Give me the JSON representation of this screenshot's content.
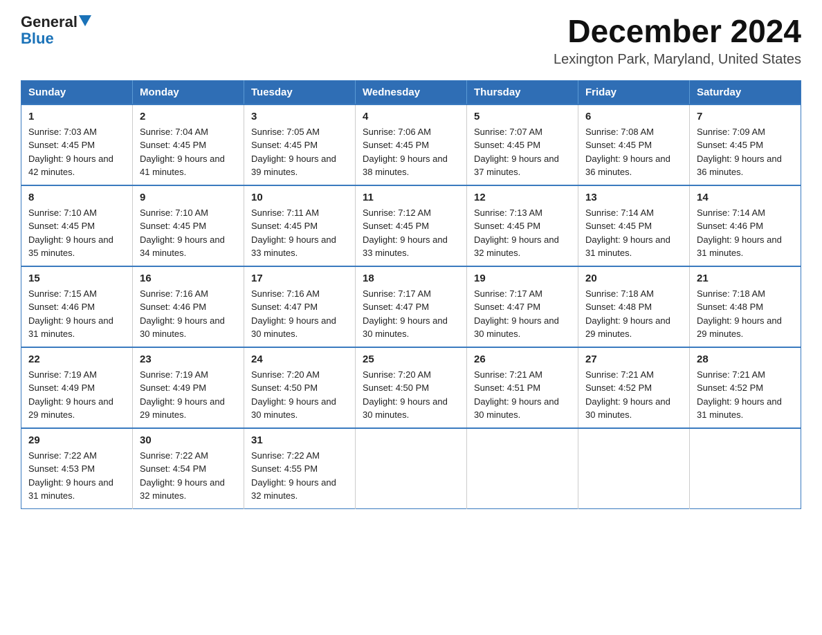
{
  "logo": {
    "general": "General",
    "blue": "Blue",
    "triangle": true
  },
  "title": "December 2024",
  "subtitle": "Lexington Park, Maryland, United States",
  "weekdays": [
    "Sunday",
    "Monday",
    "Tuesday",
    "Wednesday",
    "Thursday",
    "Friday",
    "Saturday"
  ],
  "weeks": [
    [
      {
        "day": "1",
        "sunrise": "7:03 AM",
        "sunset": "4:45 PM",
        "daylight": "9 hours and 42 minutes."
      },
      {
        "day": "2",
        "sunrise": "7:04 AM",
        "sunset": "4:45 PM",
        "daylight": "9 hours and 41 minutes."
      },
      {
        "day": "3",
        "sunrise": "7:05 AM",
        "sunset": "4:45 PM",
        "daylight": "9 hours and 39 minutes."
      },
      {
        "day": "4",
        "sunrise": "7:06 AM",
        "sunset": "4:45 PM",
        "daylight": "9 hours and 38 minutes."
      },
      {
        "day": "5",
        "sunrise": "7:07 AM",
        "sunset": "4:45 PM",
        "daylight": "9 hours and 37 minutes."
      },
      {
        "day": "6",
        "sunrise": "7:08 AM",
        "sunset": "4:45 PM",
        "daylight": "9 hours and 36 minutes."
      },
      {
        "day": "7",
        "sunrise": "7:09 AM",
        "sunset": "4:45 PM",
        "daylight": "9 hours and 36 minutes."
      }
    ],
    [
      {
        "day": "8",
        "sunrise": "7:10 AM",
        "sunset": "4:45 PM",
        "daylight": "9 hours and 35 minutes."
      },
      {
        "day": "9",
        "sunrise": "7:10 AM",
        "sunset": "4:45 PM",
        "daylight": "9 hours and 34 minutes."
      },
      {
        "day": "10",
        "sunrise": "7:11 AM",
        "sunset": "4:45 PM",
        "daylight": "9 hours and 33 minutes."
      },
      {
        "day": "11",
        "sunrise": "7:12 AM",
        "sunset": "4:45 PM",
        "daylight": "9 hours and 33 minutes."
      },
      {
        "day": "12",
        "sunrise": "7:13 AM",
        "sunset": "4:45 PM",
        "daylight": "9 hours and 32 minutes."
      },
      {
        "day": "13",
        "sunrise": "7:14 AM",
        "sunset": "4:45 PM",
        "daylight": "9 hours and 31 minutes."
      },
      {
        "day": "14",
        "sunrise": "7:14 AM",
        "sunset": "4:46 PM",
        "daylight": "9 hours and 31 minutes."
      }
    ],
    [
      {
        "day": "15",
        "sunrise": "7:15 AM",
        "sunset": "4:46 PM",
        "daylight": "9 hours and 31 minutes."
      },
      {
        "day": "16",
        "sunrise": "7:16 AM",
        "sunset": "4:46 PM",
        "daylight": "9 hours and 30 minutes."
      },
      {
        "day": "17",
        "sunrise": "7:16 AM",
        "sunset": "4:47 PM",
        "daylight": "9 hours and 30 minutes."
      },
      {
        "day": "18",
        "sunrise": "7:17 AM",
        "sunset": "4:47 PM",
        "daylight": "9 hours and 30 minutes."
      },
      {
        "day": "19",
        "sunrise": "7:17 AM",
        "sunset": "4:47 PM",
        "daylight": "9 hours and 30 minutes."
      },
      {
        "day": "20",
        "sunrise": "7:18 AM",
        "sunset": "4:48 PM",
        "daylight": "9 hours and 29 minutes."
      },
      {
        "day": "21",
        "sunrise": "7:18 AM",
        "sunset": "4:48 PM",
        "daylight": "9 hours and 29 minutes."
      }
    ],
    [
      {
        "day": "22",
        "sunrise": "7:19 AM",
        "sunset": "4:49 PM",
        "daylight": "9 hours and 29 minutes."
      },
      {
        "day": "23",
        "sunrise": "7:19 AM",
        "sunset": "4:49 PM",
        "daylight": "9 hours and 29 minutes."
      },
      {
        "day": "24",
        "sunrise": "7:20 AM",
        "sunset": "4:50 PM",
        "daylight": "9 hours and 30 minutes."
      },
      {
        "day": "25",
        "sunrise": "7:20 AM",
        "sunset": "4:50 PM",
        "daylight": "9 hours and 30 minutes."
      },
      {
        "day": "26",
        "sunrise": "7:21 AM",
        "sunset": "4:51 PM",
        "daylight": "9 hours and 30 minutes."
      },
      {
        "day": "27",
        "sunrise": "7:21 AM",
        "sunset": "4:52 PM",
        "daylight": "9 hours and 30 minutes."
      },
      {
        "day": "28",
        "sunrise": "7:21 AM",
        "sunset": "4:52 PM",
        "daylight": "9 hours and 31 minutes."
      }
    ],
    [
      {
        "day": "29",
        "sunrise": "7:22 AM",
        "sunset": "4:53 PM",
        "daylight": "9 hours and 31 minutes."
      },
      {
        "day": "30",
        "sunrise": "7:22 AM",
        "sunset": "4:54 PM",
        "daylight": "9 hours and 32 minutes."
      },
      {
        "day": "31",
        "sunrise": "7:22 AM",
        "sunset": "4:55 PM",
        "daylight": "9 hours and 32 minutes."
      },
      null,
      null,
      null,
      null
    ]
  ]
}
